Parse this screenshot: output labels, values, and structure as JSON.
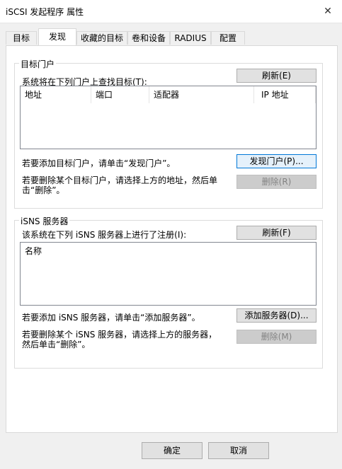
{
  "window": {
    "title": "iSCSI 发起程序 属性",
    "close_glyph": "✕"
  },
  "tabs": [
    {
      "label": "目标"
    },
    {
      "label": "发现"
    },
    {
      "label": "收藏的目标"
    },
    {
      "label": "卷和设备"
    },
    {
      "label": "RADIUS"
    },
    {
      "label": "配置"
    }
  ],
  "portals": {
    "group_title": "目标门户",
    "instruction": "系统将在下列门户上查找目标(T):",
    "refresh_label": "刷新(E)",
    "columns": [
      "地址",
      "端口",
      "适配器",
      "IP 地址"
    ],
    "add_hint": "若要添加目标门户，请单击“发现门户”。",
    "discover_label": "发现门户(P)...",
    "remove_hint_line1": "若要删除某个目标门户，请选择上方的地址，然后单",
    "remove_hint_line2": "击“删除”。",
    "remove_label": "删除(R)"
  },
  "isns": {
    "group_title": "iSNS 服务器",
    "instruction": "该系统在下列 iSNS 服务器上进行了注册(I):",
    "refresh_label": "刷新(F)",
    "columns": [
      "名称"
    ],
    "add_hint": "若要添加 iSNS 服务器，请单击“添加服务器”。",
    "add_label": "添加服务器(D)...",
    "remove_hint_line1": "若要删除某个 iSNS 服务器，请选择上方的服务器，",
    "remove_hint_line2": "然后单击“删除”。",
    "remove_label": "删除(M)"
  },
  "footer": {
    "ok_label": "确定",
    "cancel_label": "取消"
  }
}
